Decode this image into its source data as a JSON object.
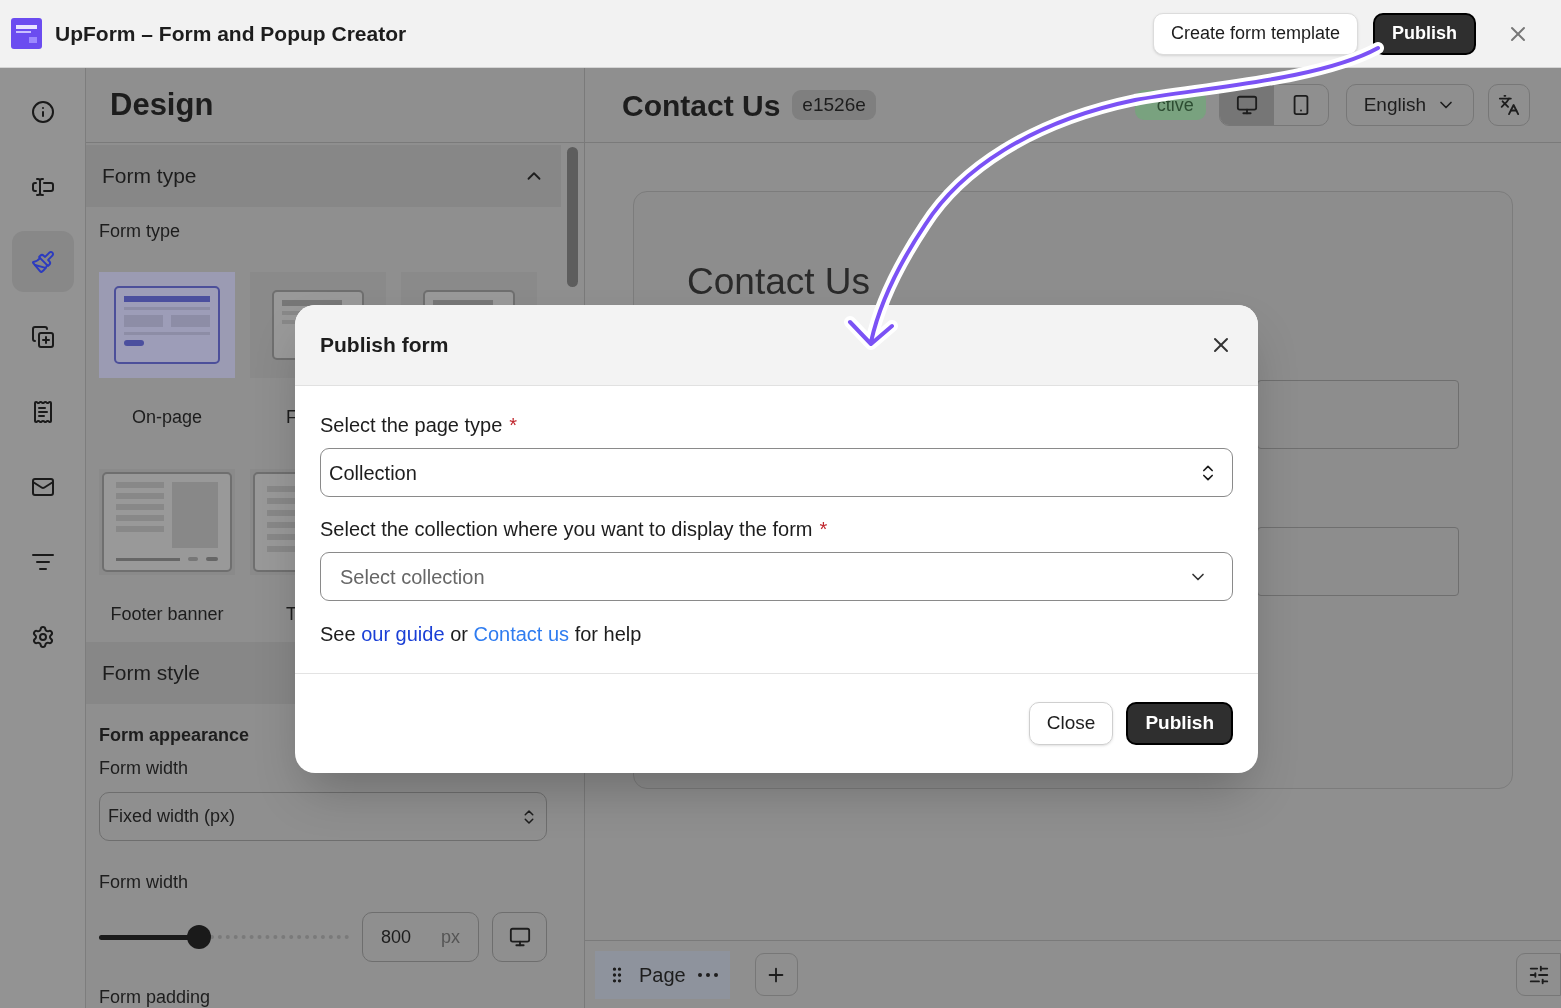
{
  "app": {
    "title": "UpForm – Form and Popup Creator"
  },
  "header_actions": {
    "template_button": "Create form template",
    "publish_button": "Publish"
  },
  "rail": [
    {
      "kind": "info",
      "selected": false
    },
    {
      "kind": "input",
      "selected": false
    },
    {
      "kind": "brush",
      "selected": true
    },
    {
      "kind": "layers",
      "selected": false
    },
    {
      "kind": "receipt",
      "selected": false
    },
    {
      "kind": "mail",
      "selected": false
    },
    {
      "kind": "filter",
      "selected": false
    },
    {
      "kind": "settings",
      "selected": false
    }
  ],
  "design_panel": {
    "title": "Design",
    "form_type_section": {
      "title": "Form type",
      "expanded": true,
      "label": "Form type",
      "options": [
        {
          "kind": "onpage",
          "label": "On-page",
          "selected": true,
          "truncated": false
        },
        {
          "kind": "popup",
          "label": "F",
          "selected": false,
          "truncated": true
        },
        {
          "kind": "popup",
          "selected": false
        },
        {
          "kind": "footer",
          "label": "Footer banner",
          "selected": false,
          "truncated": false
        },
        {
          "kind": "side",
          "label": "T",
          "selected": false,
          "truncated": true
        }
      ]
    },
    "form_style_section": {
      "title": "Form style",
      "appearance_title": "Form appearance",
      "width_mode_label": "Form width",
      "width_mode": "Fixed width (px)",
      "width_label": "Form width",
      "level": 0.4,
      "width_value": "800",
      "width_unit": "px",
      "padding_label": "Form padding"
    }
  },
  "editor": {
    "title": "Contact Us",
    "id_badge": "e1526e",
    "status": "ctive",
    "devices": [
      {
        "kind": "desktop",
        "selected": true
      },
      {
        "kind": "mobile",
        "selected": false
      }
    ],
    "language": "English",
    "preview_heading": "Contact Us",
    "page_tab": "Page"
  },
  "dialog": {
    "title": "Publish form",
    "page_type_label": "Select the page type",
    "page_type_required": "*",
    "page_type_value": "Collection",
    "collection_label": "Select the collection where you want to display the form",
    "collection_required": "*",
    "collection_placeholder": "Select collection",
    "help": {
      "before": "See",
      "link_1": "our guide",
      "middle": "or",
      "link_2": "Contact us",
      "after": "for help"
    },
    "close_button": "Close",
    "publish_button": "Publish"
  }
}
